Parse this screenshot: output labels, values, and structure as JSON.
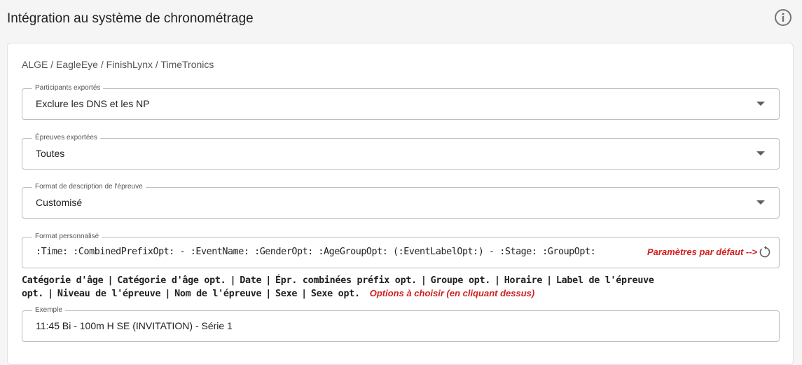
{
  "header": {
    "title": "Intégration au système de chronométrage",
    "info_icon": "info-circle-icon"
  },
  "section": {
    "title": "ALGE / EagleEye / FinishLynx / TimeTronics"
  },
  "fields": {
    "participants": {
      "label": "Participants exportés",
      "value": "Exclure les DNS et les NP"
    },
    "events": {
      "label": "Épreuves exportées",
      "value": "Toutes"
    },
    "format": {
      "label": "Format de description de l'épreuve",
      "value": "Customisé"
    },
    "custom_format": {
      "label": "Format personnalisé",
      "value": ":Time: :CombinedPrefixOpt: - :EventName: :GenderOpt: :AgeGroupOpt: (:EventLabelOpt:) - :Stage: :GroupOpt:",
      "reset_hint": "Paramètres par défaut -->",
      "reset_icon": "reset-icon"
    },
    "example": {
      "label": "Exemple",
      "value": "11:45 Bi - 100m H SE (INVITATION) - Série 1"
    }
  },
  "options": {
    "items": [
      "Catégorie d'âge",
      "Catégorie d'âge opt.",
      "Date",
      "Épr. combinées préfix opt.",
      "Groupe opt.",
      "Horaire",
      "Label de l'épreuve opt.",
      "Niveau de l'épreuve",
      "Nom de l'épreuve",
      "Sexe",
      "Sexe opt."
    ],
    "separator": "|",
    "hint": "Options à choisir (en cliquant dessus)"
  },
  "colors": {
    "hint_red": "#d01f1f",
    "border": "#bdbdbd",
    "background": "#f5f5f5"
  }
}
